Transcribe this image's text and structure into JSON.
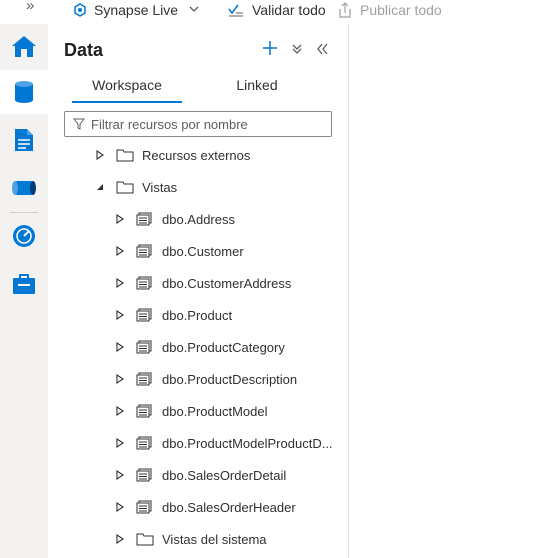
{
  "toolbar": {
    "collapse_glyph": "»",
    "workspace_name": "Synapse Live",
    "validate_label": "Validar todo",
    "publish_label": "Publicar todo"
  },
  "rail": {
    "items": [
      {
        "name": "home-icon",
        "active": false
      },
      {
        "name": "data-icon",
        "active": true
      },
      {
        "name": "develop-icon",
        "active": false
      },
      {
        "name": "integrate-icon",
        "active": false
      },
      {
        "name": "monitor-icon",
        "active": false
      },
      {
        "name": "manage-icon",
        "active": false
      }
    ]
  },
  "panel": {
    "title": "Data",
    "tabs": [
      {
        "label": "Workspace",
        "selected": true
      },
      {
        "label": "Linked",
        "selected": false
      }
    ],
    "filter_placeholder": "Filtrar recursos por nombre",
    "tree": {
      "external": "Recursos externos",
      "views": "Vistas",
      "view_items": [
        "dbo.Address",
        "dbo.Customer",
        "dbo.CustomerAddress",
        "dbo.Product",
        "dbo.ProductCategory",
        "dbo.ProductDescription",
        "dbo.ProductModel",
        "dbo.ProductModelProductD...",
        "dbo.SalesOrderDetail",
        "dbo.SalesOrderHeader"
      ],
      "system_views": "Vistas del sistema"
    }
  },
  "colors": {
    "accent": "#0078d4",
    "rail_bg": "#f3f2f1"
  }
}
